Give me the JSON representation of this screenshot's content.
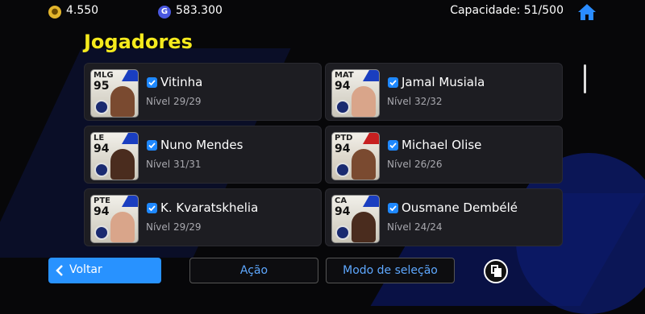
{
  "header": {
    "coins": "4.550",
    "gp": "583.300",
    "capacity": "Capacidade: 51/500",
    "coin_icon": "coin-icon",
    "gp_icon": "gp-icon",
    "gp_letter": "G",
    "home_icon": "home-icon"
  },
  "title": "Jogadores",
  "players": [
    {
      "pos": "MLG",
      "ovr": "95",
      "name": "Vitinha",
      "level": "Nível 29/29"
    },
    {
      "pos": "MAT",
      "ovr": "94",
      "name": "Jamal Musiala",
      "level": "Nível 32/32"
    },
    {
      "pos": "LE",
      "ovr": "94",
      "name": "Nuno Mendes",
      "level": "Nível 31/31"
    },
    {
      "pos": "PTD",
      "ovr": "94",
      "name": "Michael Olise",
      "level": "Nível 26/26"
    },
    {
      "pos": "PTE",
      "ovr": "94",
      "name": "K. Kvaratskhelia",
      "level": "Nível 29/29"
    },
    {
      "pos": "CA",
      "ovr": "94",
      "name": "Ousmane Dembélé",
      "level": "Nível 24/24"
    }
  ],
  "footer": {
    "back": "Voltar",
    "action": "Ação",
    "selection_mode": "Modo de seleção"
  },
  "colors": {
    "accent": "#2892ff",
    "title": "#f5ea1d"
  }
}
